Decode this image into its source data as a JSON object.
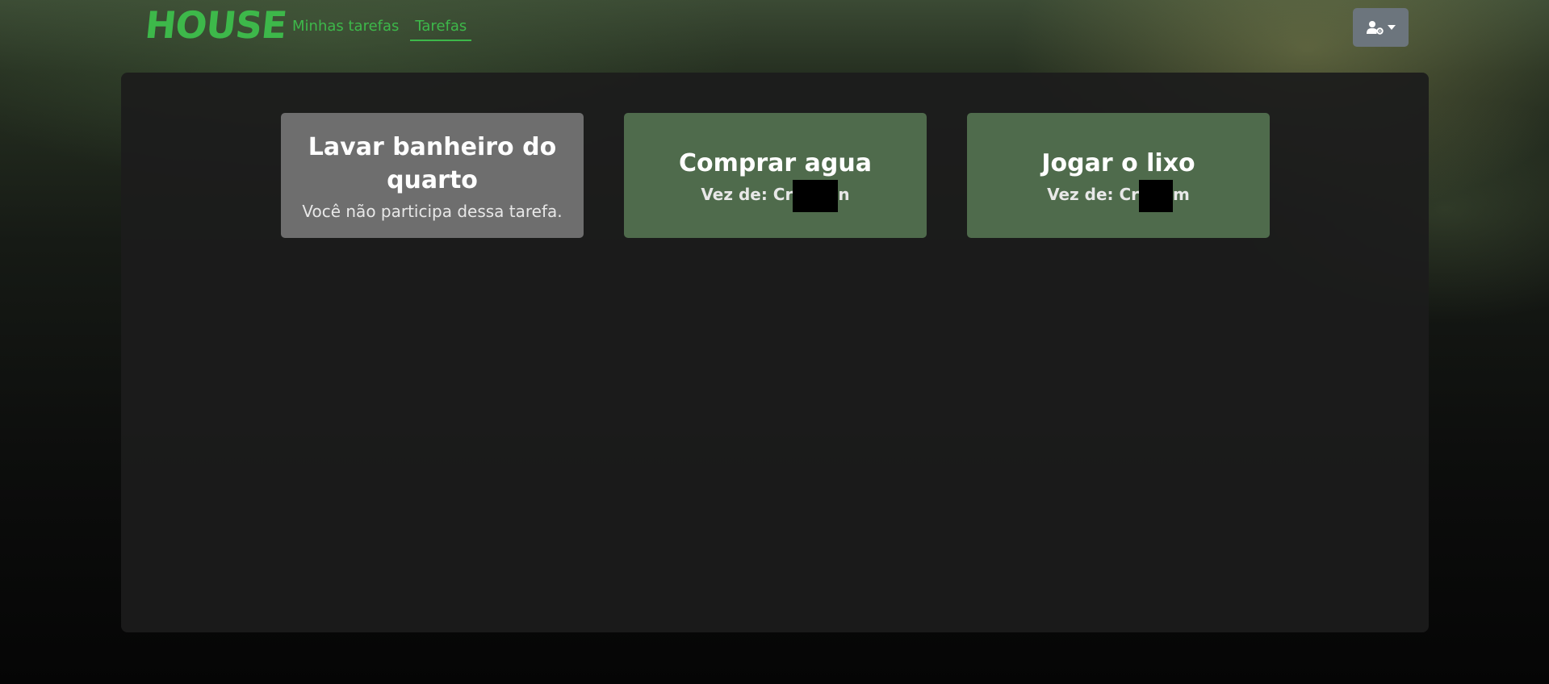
{
  "navbar": {
    "logo_text": "HOUSE",
    "links": [
      {
        "label": "Minhas tarefas",
        "active": false
      },
      {
        "label": "Tarefas",
        "active": true
      }
    ],
    "user_menu": {
      "icon": "user-cog-icon",
      "caret": "caret-down-icon",
      "color": "#6c757d"
    }
  },
  "colors": {
    "brand_green": "#3db84a",
    "card_gray": "#6e6e6e",
    "card_green": "#4f6b4c"
  },
  "tasks": [
    {
      "title": "Lavar banheiro do quarto",
      "subtitle": "Você não participa dessa tarefa.",
      "participating": false
    },
    {
      "title": "Comprar agua",
      "turn_prefix": "Vez de: Cr",
      "turn_suffix": "n",
      "participating": true
    },
    {
      "title": "Jogar o lixo",
      "turn_prefix": "Vez de: Cr",
      "turn_suffix": "m",
      "participating": true
    }
  ]
}
